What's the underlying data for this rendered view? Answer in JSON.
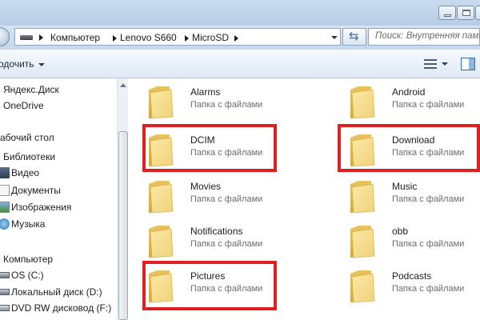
{
  "window": {
    "controls": [
      "minimize",
      "maximize",
      "close"
    ]
  },
  "address_bar": {
    "crumbs": [
      "Компьютер",
      "Lenovo S660",
      "MicroSD"
    ],
    "search_placeholder": "Поиск: Внутренняя памя"
  },
  "toolbar": {
    "organize_label": "одочить"
  },
  "nav_pane": {
    "items": [
      {
        "label": "Яндекс.Диск",
        "icon": "yandex-disk-icon"
      },
      {
        "label": "OneDrive",
        "icon": "onedrive-icon"
      },
      {
        "label": "абочий стол",
        "icon": "desktop-icon"
      },
      {
        "label": "Библиотеки",
        "icon": "libraries-icon"
      },
      {
        "label": "Видео",
        "icon": "video-icon"
      },
      {
        "label": "Документы",
        "icon": "documents-icon"
      },
      {
        "label": "Изображения",
        "icon": "pictures-icon"
      },
      {
        "label": "Музыка",
        "icon": "music-icon"
      },
      {
        "label": "Компьютер",
        "icon": "computer-icon"
      },
      {
        "label": "OS (C:)",
        "icon": "drive-icon"
      },
      {
        "label": "Локальный диск (D:)",
        "icon": "drive-icon"
      },
      {
        "label": "DVD RW дисковод (F:)",
        "icon": "dvd-drive-icon"
      }
    ]
  },
  "folders": [
    {
      "name": "Alarms",
      "type": "Папка с файлами",
      "highlighted": false
    },
    {
      "name": "Android",
      "type": "Папка с файлами",
      "highlighted": false
    },
    {
      "name": "DCIM",
      "type": "Папка с файлами",
      "highlighted": true
    },
    {
      "name": "Download",
      "type": "Папка с файлами",
      "highlighted": true
    },
    {
      "name": "Movies",
      "type": "Папка с файлами",
      "highlighted": false
    },
    {
      "name": "Music",
      "type": "Папка с файлами",
      "highlighted": false
    },
    {
      "name": "Notifications",
      "type": "Папка с файлами",
      "highlighted": false
    },
    {
      "name": "obb",
      "type": "Папка с файлами",
      "highlighted": false
    },
    {
      "name": "Pictures",
      "type": "Папка с файлами",
      "highlighted": true
    },
    {
      "name": "Podcasts",
      "type": "Папка с файлами",
      "highlighted": false
    }
  ],
  "colors": {
    "highlight": "#e02020",
    "folder": "#f2d37a"
  }
}
